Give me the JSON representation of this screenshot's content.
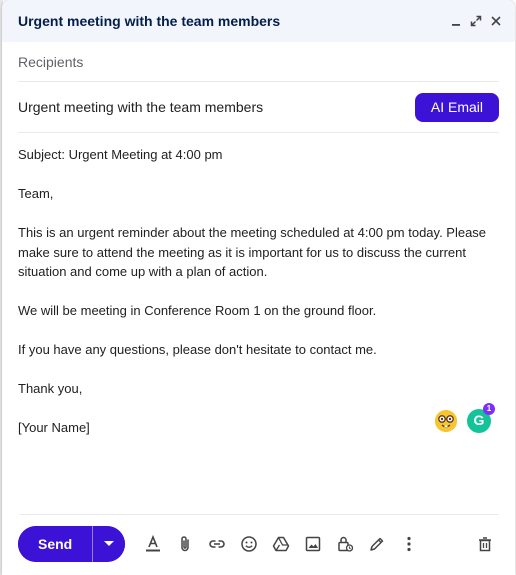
{
  "window": {
    "title": "Urgent meeting with the team members"
  },
  "recipients": {
    "placeholder": "Recipients"
  },
  "subject": {
    "value": "Urgent meeting with the team members",
    "ai_button_label": "AI Email"
  },
  "body": {
    "lines": [
      "Subject: Urgent Meeting at 4:00 pm",
      "Team,",
      "This is an urgent reminder about the meeting scheduled at 4:00 pm today. Please make sure to attend the meeting as it is important for us to discuss the current situation and come up with a plan of action.",
      "We will be meeting in Conference Room 1 on the ground floor.",
      "If you have any questions, please don't hesitate to contact me.",
      "Thank you,",
      "[Your Name]"
    ]
  },
  "extensions": {
    "grammarly_letter": "G",
    "grammarly_badge": "1"
  },
  "toolbar": {
    "send_label": "Send",
    "icons": [
      "text-format-icon",
      "attach-icon",
      "link-icon",
      "emoji-icon",
      "drive-icon",
      "photo-icon",
      "confidential-icon",
      "signature-icon",
      "more-options-icon",
      "delete-icon"
    ]
  },
  "colors": {
    "accent": "#3c13d6",
    "title_bar": "#f2f6fc"
  }
}
